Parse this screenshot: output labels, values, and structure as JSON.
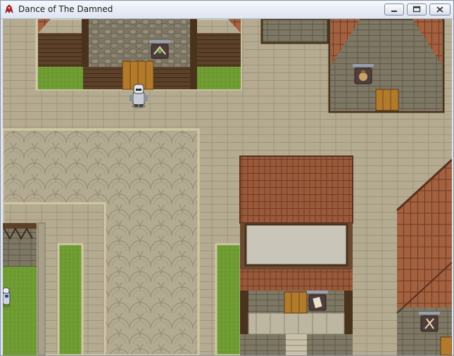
{
  "window": {
    "title": "Dance of The Damned",
    "icon": "app-icon-red-creature"
  },
  "controls": {
    "minimize_icon": "minimize-icon",
    "maximize_icon": "maximize-icon",
    "close_icon": "close-icon"
  },
  "scene": {
    "signs": [
      "potion-shop-sign",
      "item-shop-sign",
      "armor-shop-sign",
      "weapon-shop-sign"
    ],
    "characters": [
      "player-knight-character",
      "npc-character"
    ],
    "colors": {
      "pavement": "#b5ab91",
      "grass": "#6e9c33",
      "roof": "#9a5a3a",
      "wood": "#5c4128"
    }
  }
}
